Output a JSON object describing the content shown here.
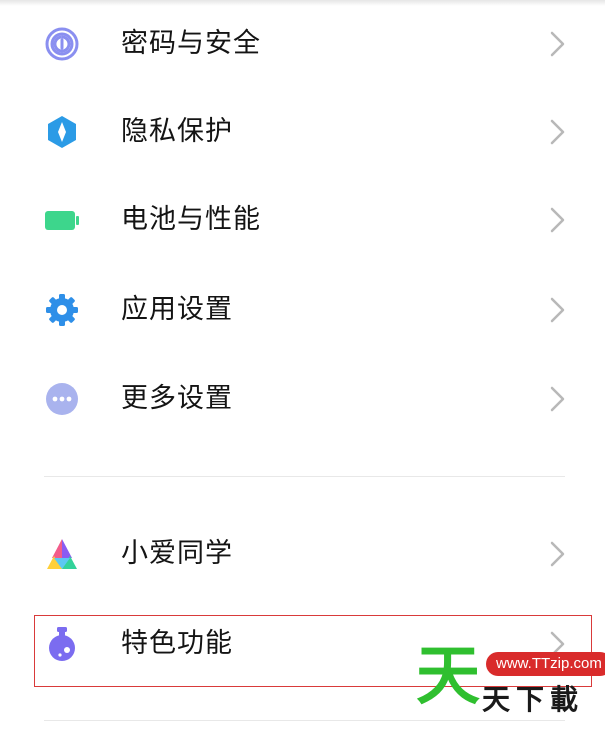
{
  "settings": {
    "items": [
      {
        "label": "密码与安全",
        "icon": "fingerprint-icon",
        "color": "#8a8ff0"
      },
      {
        "label": "隐私保护",
        "icon": "privacy-shield-icon",
        "color": "#2b9be6"
      },
      {
        "label": "电池与性能",
        "icon": "battery-icon",
        "color": "#3dd68c"
      },
      {
        "label": "应用设置",
        "icon": "gear-icon",
        "color": "#2e8fe8"
      },
      {
        "label": "更多设置",
        "icon": "more-dots-icon",
        "color": "#a9b3ee"
      },
      {
        "label": "小爱同学",
        "icon": "xiaoai-icon",
        "color": "#f25c8a"
      },
      {
        "label": "特色功能",
        "icon": "flask-icon",
        "color": "#7b6cf0"
      }
    ]
  },
  "highlight_color": "#d93a3a",
  "watermark": {
    "big": "天",
    "small": "天下載",
    "url": "www.TTzip.com"
  }
}
